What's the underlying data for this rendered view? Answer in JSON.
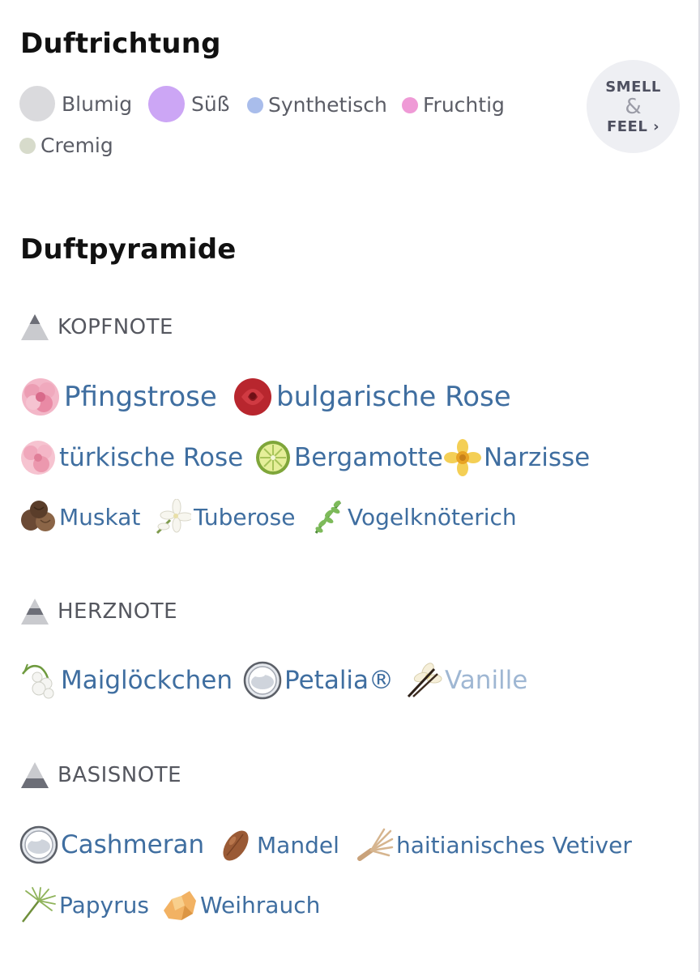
{
  "scent_direction": {
    "title": "Duftrichtung",
    "items": [
      {
        "label": "Blumig",
        "color": "#dadadd"
      },
      {
        "label": "Süß",
        "color": "#cca6f5"
      },
      {
        "label": "Synthetisch",
        "color": "#a9bdeb"
      },
      {
        "label": "Fruchtig",
        "color": "#ef9ad6"
      },
      {
        "label": "Cremig",
        "color": "#d7dbcb"
      }
    ],
    "smell_feel": {
      "line1": "SMELL",
      "line2": "&",
      "line3": "FEEL ›"
    }
  },
  "pyramid": {
    "title": "Duftpyramide",
    "top": {
      "label": "KOPFNOTE",
      "notes": [
        {
          "label": "Pfingstrose",
          "icon": "peony-icon"
        },
        {
          "label": "bulgarische Rose",
          "icon": "red-rose-icon"
        },
        {
          "label": "türkische Rose",
          "icon": "pink-rose-icon"
        },
        {
          "label": "Bergamotte",
          "icon": "bergamot-icon"
        },
        {
          "label": "Narzisse",
          "icon": "daffodil-icon"
        },
        {
          "label": "Muskat",
          "icon": "nutmeg-icon"
        },
        {
          "label": "Tuberose",
          "icon": "tuberose-icon"
        },
        {
          "label": "Vogelknöterich",
          "icon": "knotweed-icon"
        }
      ]
    },
    "heart": {
      "label": "HERZNOTE",
      "notes": [
        {
          "label": "Maiglöckchen",
          "icon": "lily-of-the-valley-icon"
        },
        {
          "label": "Petalia®",
          "icon": "molecule-drop-icon"
        },
        {
          "label": "Vanille",
          "icon": "vanilla-icon"
        }
      ]
    },
    "base": {
      "label": "BASISNOTE",
      "notes": [
        {
          "label": "Cashmeran",
          "icon": "molecule-drop-icon"
        },
        {
          "label": "Mandel",
          "icon": "almond-icon"
        },
        {
          "label": "haitianisches Vetiver",
          "icon": "vetiver-icon"
        },
        {
          "label": "Papyrus",
          "icon": "papyrus-icon"
        },
        {
          "label": "Weihrauch",
          "icon": "frankincense-icon"
        }
      ]
    }
  }
}
